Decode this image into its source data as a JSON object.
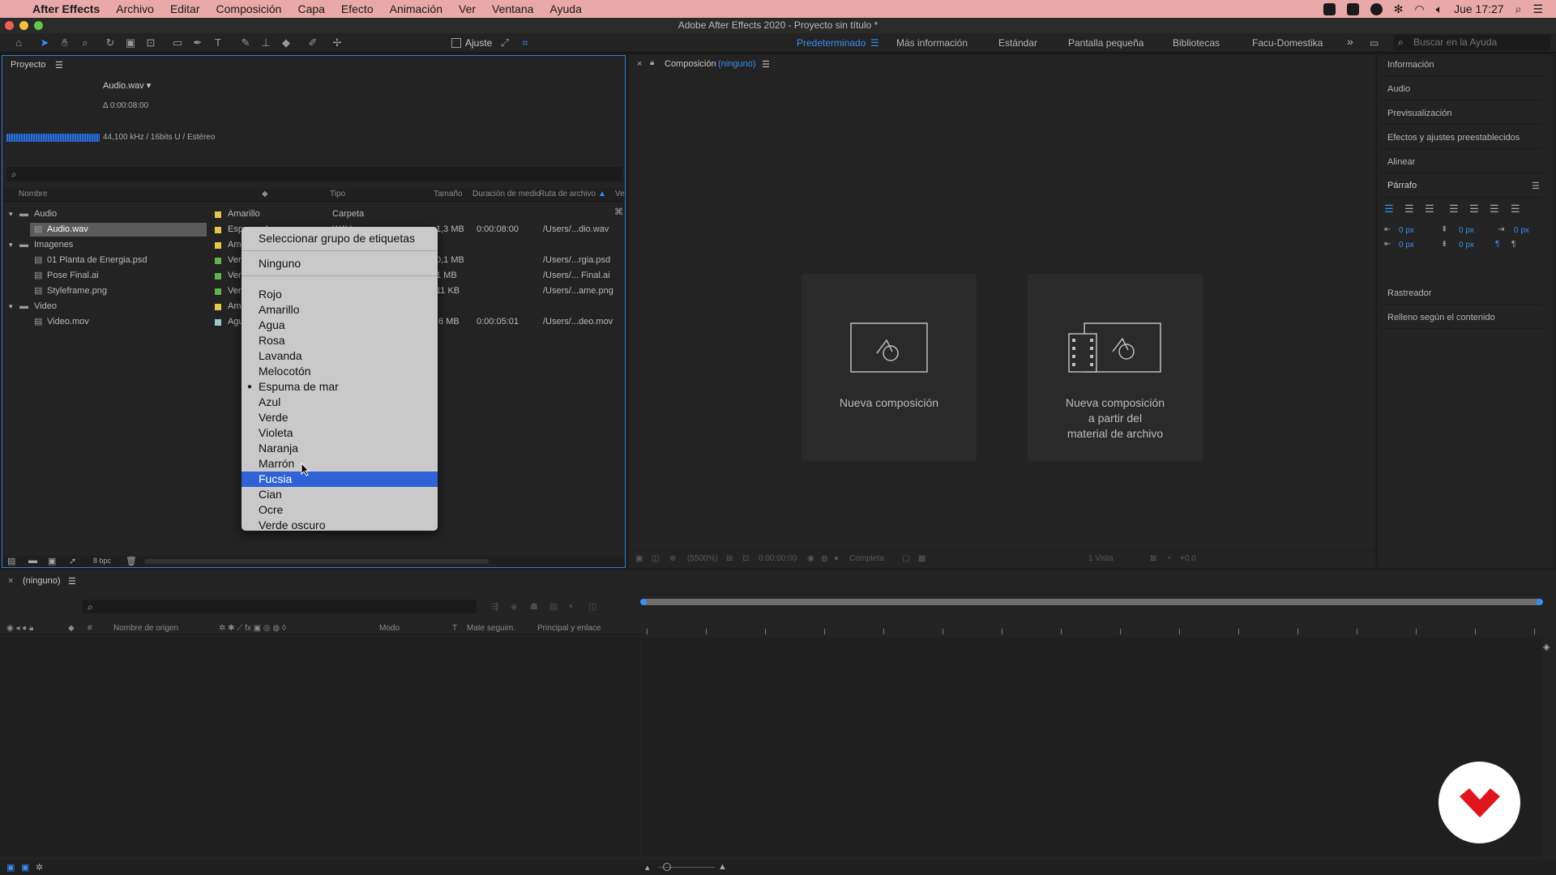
{
  "menubar": {
    "items": [
      "After Effects",
      "Archivo",
      "Editar",
      "Composición",
      "Capa",
      "Efecto",
      "Animación",
      "Ver",
      "Ventana",
      "Ayuda"
    ],
    "clock": "Jue 17:27"
  },
  "window": {
    "title": "Adobe After Effects 2020 - Proyecto sin título *"
  },
  "toolbar": {
    "snap_label": "Ajuste",
    "workspaces": [
      "Predeterminado",
      "Más información",
      "Estándar",
      "Pantalla pequeña",
      "Bibliotecas",
      "Facu-Domestika"
    ],
    "active_workspace": "Predeterminado",
    "help_search_placeholder": "Buscar en la Ayuda"
  },
  "project": {
    "title": "Proyecto",
    "selected_name": "Audio.wav ▾",
    "selected_duration": "Δ 0:00:08:00",
    "audio_info": "44,100 kHz / 16bits U / Estéreo",
    "columns": [
      "Nombre",
      "Tipo",
      "Tamaño",
      "Duración de medio",
      "Ruta de archivo",
      "Ve"
    ],
    "rows": [
      {
        "name": "Audio",
        "label": "Amarillo",
        "type": "Carpeta",
        "size": "",
        "duration": "",
        "path": "",
        "color": "#e3c64b",
        "folder": true
      },
      {
        "name": "Audio.wav",
        "label": "Espuma de mar",
        "type": "WAV",
        "size": "1,3 MB",
        "duration": "0:00:08:00",
        "path": "/Users/...dio.wav",
        "color": "#e3c64b",
        "folder": false
      },
      {
        "name": "Imagenes",
        "label": "Ama",
        "type": "",
        "size": "",
        "duration": "",
        "path": "",
        "color": "#e3c64b",
        "folder": true
      },
      {
        "name": "01 Planta de Energia.psd",
        "label": "Verd",
        "type": "",
        "size": "0,1 MB",
        "duration": "",
        "path": "/Users/...rgia.psd",
        "color": "#5fb44f",
        "folder": false
      },
      {
        "name": "Pose Final.ai",
        "label": "Verd",
        "type": "",
        "size": "1 MB",
        "duration": "",
        "path": "/Users/... Final.ai",
        "color": "#5fb44f",
        "folder": false
      },
      {
        "name": "Styleframe.png",
        "label": "Verd",
        "type": "",
        "size": "11 KB",
        "duration": "",
        "path": "/Users/...ame.png",
        "color": "#5fb44f",
        "folder": false
      },
      {
        "name": "Video",
        "label": "Ama",
        "type": "",
        "size": "",
        "duration": "",
        "path": "",
        "color": "#e3c64b",
        "folder": true
      },
      {
        "name": "Video.mov",
        "label": "Agu",
        "type": "",
        "size": ",6 MB",
        "duration": "0:00:05:01",
        "path": "/Users/...deo.mov",
        "color": "#9fc6c9",
        "folder": false
      }
    ],
    "bpc": "8 bpc"
  },
  "context_menu": {
    "header": "Seleccionar grupo de etiquetas",
    "none": "Ninguno",
    "colors": [
      "Rojo",
      "Amarillo",
      "Agua",
      "Rosa",
      "Lavanda",
      "Melocotón",
      "Espuma de mar",
      "Azul",
      "Verde",
      "Violeta",
      "Naranja",
      "Marrón",
      "Fucsia",
      "Cian",
      "Ocre",
      "Verde oscuro"
    ],
    "checked": "Espuma de mar",
    "highlighted": "Fucsia"
  },
  "composition": {
    "title": "Composición",
    "title_value": "(ninguno)",
    "new_comp": "Nueva composición",
    "new_comp_footage": [
      "Nueva composición",
      "a partir del",
      "material de archivo"
    ],
    "zoom": "(5500%)",
    "timecode": "0:00:00:00",
    "resolution": "Completa",
    "views": "1 Vista",
    "exposure": "+0,0"
  },
  "right_panel": {
    "items": [
      "Información",
      "Audio",
      "Previsualización",
      "Efectos y ajustes preestablecidos",
      "Alinear"
    ],
    "paragraph_title": "Párrafo",
    "px_values": [
      "0 px",
      "0 px",
      "0 px",
      "0 px",
      "0 px"
    ],
    "items2": [
      "Rastreador",
      "Relleno según el contenido"
    ]
  },
  "timeline": {
    "tab": "(ninguno)",
    "columns": [
      "#",
      "Nombre de origen",
      "Modo",
      "T",
      "Mate seguim.",
      "Principal y enlace"
    ]
  }
}
